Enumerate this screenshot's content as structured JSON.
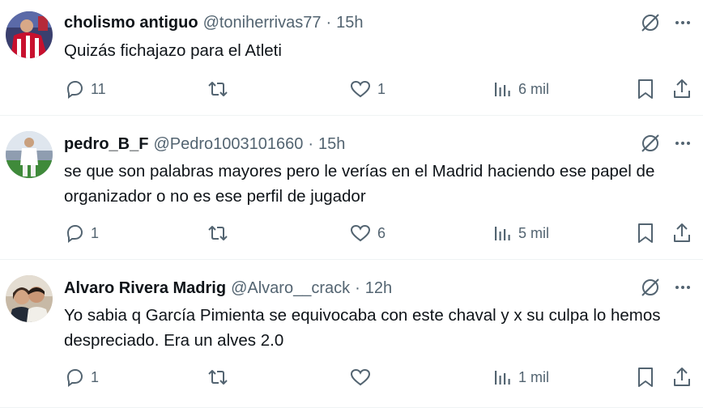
{
  "tweets": [
    {
      "name": "cholismo antiguo",
      "handle": "@toniherrivas77",
      "separator": "·",
      "time": "15h",
      "text": "Quizás fichajazo para el Atleti",
      "replies": "11",
      "retweets": "",
      "likes": "1",
      "views": "6 mil"
    },
    {
      "name": "pedro_B_F",
      "handle": "@Pedro1003101660",
      "separator": "·",
      "time": "15h",
      "text": "se que son palabras mayores pero le verías en el Madrid haciendo ese papel de organizador o no es ese perfil de jugador",
      "replies": "1",
      "retweets": "",
      "likes": "6",
      "views": "5 mil"
    },
    {
      "name": "Alvaro Rivera Madrig",
      "handle": "@Alvaro__crack",
      "separator": "·",
      "time": "12h",
      "text": "Yo sabia q García Pimienta se equivocaba con este chaval y x su culpa lo hemos despreciado. Era un alves 2.0",
      "replies": "1",
      "retweets": "",
      "likes": "",
      "views": "1 mil"
    }
  ],
  "icons": {
    "reply": "reply-icon",
    "retweet": "retweet-icon",
    "like": "heart-icon",
    "views": "views-icon",
    "bookmark": "bookmark-icon",
    "share": "share-icon",
    "grok": "grok-icon",
    "more": "more-icon"
  },
  "colors": {
    "text": "#0f1419",
    "secondary": "#536471",
    "divider": "#eff3f4"
  }
}
